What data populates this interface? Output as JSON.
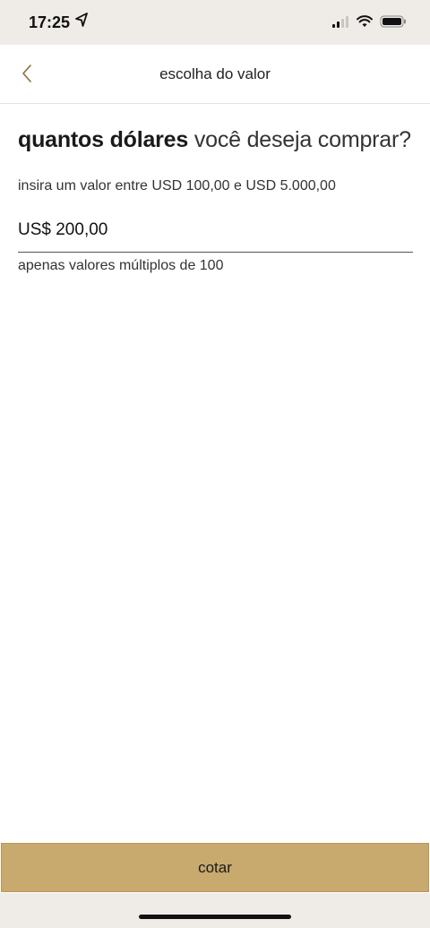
{
  "status_bar": {
    "time": "17:25",
    "icons": [
      "location-arrow-icon",
      "signal-icon",
      "wifi-icon",
      "battery-icon"
    ]
  },
  "nav": {
    "title": "escolha do valor",
    "back_icon": "chevron-left-icon"
  },
  "main": {
    "heading_bold": "quantos dólares",
    "heading_light": "você deseja comprar?",
    "subtitle": "insira um valor entre USD 100,00 e USD 5.000,00",
    "amount_value": "US$ 200,00",
    "hint": "apenas valores múltiplos de 100"
  },
  "footer": {
    "button_label": "cotar"
  },
  "colors": {
    "accent": "#c8a96e",
    "status_bg": "#efebe7",
    "back_chevron": "#8a6d3b"
  }
}
